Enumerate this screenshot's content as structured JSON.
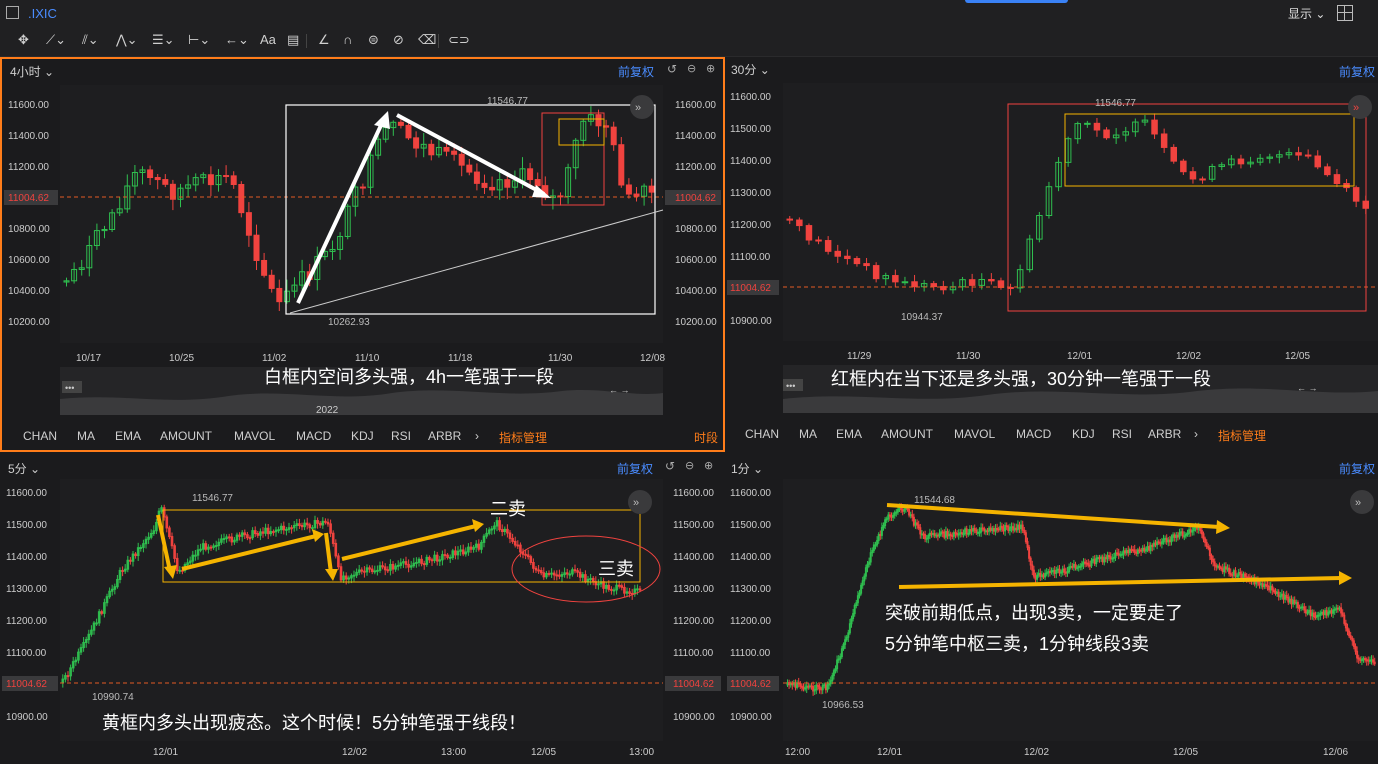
{
  "window": {
    "symbol": ".IXIC",
    "display_label": "显示"
  },
  "toolbar": {
    "icons": [
      "move-icon",
      "line-icon",
      "channel-icon",
      "wave-icon",
      "fib-icon",
      "range-icon",
      "arrow-icon",
      "text-icon",
      "note-icon",
      "ruler-icon",
      "magnet-icon",
      "lock-icon",
      "hide-icon",
      "trash-icon",
      "link-icon"
    ],
    "text_tool": "Aa"
  },
  "panels": {
    "p4h": {
      "timeframe": "4小时",
      "adjust": "前复权",
      "price_ticks": [
        "11600.00",
        "11400.00",
        "11200.00",
        "11000.00",
        "10800.00",
        "10600.00",
        "10400.00",
        "10200.00"
      ],
      "last_price": "11004.62",
      "high_label": "11546.77",
      "low_label": "10262.93",
      "dates": [
        "10/17",
        "10/25",
        "11/02",
        "11/10",
        "11/18",
        "11/30",
        "12/08"
      ],
      "year": "2022",
      "annotation": "白框内空间多头强，4h一笔强于一段",
      "indicators": [
        "CHAN",
        "MA",
        "EMA",
        "AMOUNT",
        "MAVOL",
        "MACD",
        "KDJ",
        "RSI",
        "ARBR"
      ],
      "more": "›",
      "manage": "指标管理",
      "period_tab": "时段"
    },
    "p30": {
      "timeframe": "30分",
      "adjust": "前复权",
      "price_ticks": [
        "11600.00",
        "11500.00",
        "11400.00",
        "11300.00",
        "11200.00",
        "11100.00",
        "11000.00",
        "10900.00"
      ],
      "last_price": "11004.62",
      "high_label": "11546.77",
      "low_label": "10944.37",
      "dates": [
        "11/29",
        "11/30",
        "12/01",
        "12/02",
        "12/05"
      ],
      "annotation": "红框内在当下还是多头强，30分钟一笔强于一段",
      "indicators": [
        "CHAN",
        "MA",
        "EMA",
        "AMOUNT",
        "MAVOL",
        "MACD",
        "KDJ",
        "RSI",
        "ARBR"
      ],
      "more": "›",
      "manage": "指标管理"
    },
    "p5": {
      "timeframe": "5分",
      "adjust": "前复权",
      "price_ticks": [
        "11600.00",
        "11500.00",
        "11400.00",
        "11300.00",
        "11200.00",
        "11100.00",
        "11000.00",
        "10900.00"
      ],
      "last_price": "11004.62",
      "high_label": "11546.77",
      "low_label": "10990.74",
      "dates": [
        "12/01",
        "12/02",
        "13:00",
        "12/05",
        "13:00"
      ],
      "label_sell2": "二卖",
      "label_sell3": "三卖",
      "annotation": "黄框内多头出现疲态。这个时候！5分钟笔强于线段！"
    },
    "p1": {
      "timeframe": "1分",
      "adjust": "前复权",
      "price_ticks": [
        "11600.00",
        "11500.00",
        "11400.00",
        "11300.00",
        "11200.00",
        "11100.00",
        "11000.00",
        "10900.00"
      ],
      "last_price": "11004.62",
      "high_label": "11544.68",
      "low_label": "10966.53",
      "dates": [
        "12:00",
        "12/01",
        "12/02",
        "12/05",
        "12/06"
      ],
      "annotation_line1": "突破前期低点，出现3卖，一定要走了",
      "annotation_line2": "5分钟笔中枢三卖，1分钟线段3卖"
    }
  },
  "colors": {
    "up": "#2fbf4f",
    "down": "#f0433f",
    "accent": "#ff7d1a",
    "link": "#4a8cff",
    "yellow": "#f5b400"
  }
}
